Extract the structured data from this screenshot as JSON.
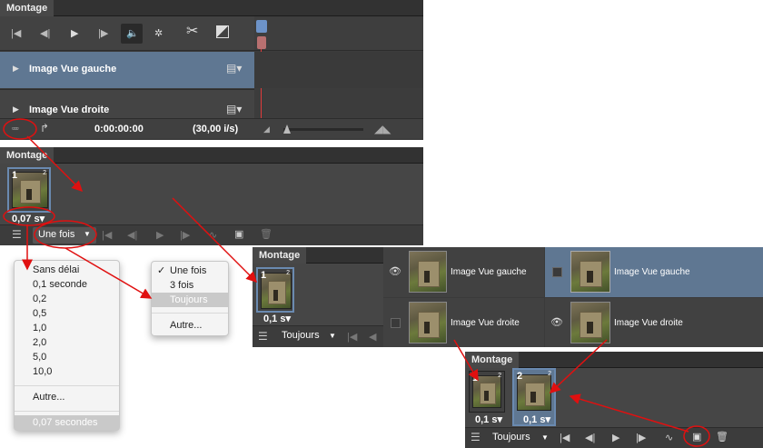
{
  "timeline": {
    "tab": "Montage",
    "layers": [
      "Image Vue gauche",
      "Image Vue droite"
    ],
    "timecode": "0:00:00:00",
    "fps": "(30,00 i/s)"
  },
  "frame_panel": {
    "tab": "Montage",
    "frame_num": "1",
    "frame_sup": "2",
    "delay": "0,07 s▾",
    "loop": "Une fois"
  },
  "delay_menu": {
    "items": [
      "Sans délai",
      "0,1 seconde",
      "0,2",
      "0,5",
      "1,0",
      "2,0",
      "5,0",
      "10,0"
    ],
    "other": "Autre...",
    "current": "0,07 secondes"
  },
  "loop_menu": {
    "items": [
      "Une fois",
      "3 fois",
      "Toujours"
    ],
    "checked": "✓",
    "other": "Autre..."
  },
  "panel2": {
    "tab": "Montage",
    "frame_num": "1",
    "frame_sup": "2",
    "delay": "0,1 s▾",
    "loop": "Toujours",
    "layers": [
      "Image Vue gauche",
      "Image Vue droite",
      "Image Vue gauche",
      "Image Vue droite"
    ]
  },
  "panel3": {
    "tab": "Montage",
    "frames": [
      {
        "num": "1",
        "sup": "2",
        "delay": "0,1 s▾"
      },
      {
        "num": "2",
        "sup": "2",
        "delay": "0,1 s▾"
      }
    ],
    "loop": "Toujours"
  }
}
